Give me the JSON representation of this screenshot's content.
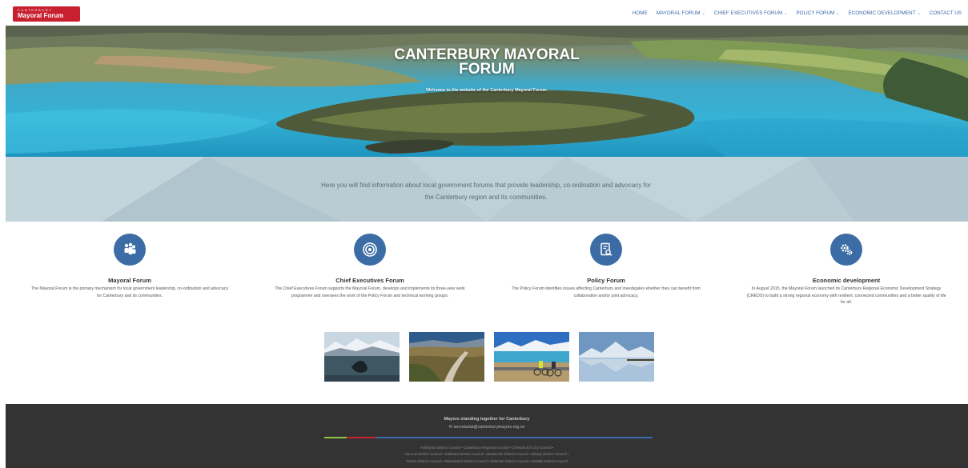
{
  "header": {
    "logo_line1": "CANTERBURY",
    "logo_line2": "Mayoral Forum",
    "nav": [
      {
        "label": "HOME",
        "has_dropdown": false
      },
      {
        "label": "MAYORAL FORUM",
        "has_dropdown": true
      },
      {
        "label": "CHIEF EXECUTIVES FORUM",
        "has_dropdown": true
      },
      {
        "label": "POLICY FORUM",
        "has_dropdown": true
      },
      {
        "label": "ECONOMIC DEVELOPMENT",
        "has_dropdown": true
      },
      {
        "label": "CONTACT US",
        "has_dropdown": false
      }
    ]
  },
  "hero": {
    "title_line1": "CANTERBURY MAYORAL",
    "title_line2": "FORUM",
    "subtitle": "Welcome to the website of the Canterbury Mayoral Forum."
  },
  "intro": {
    "text": "Here you will find information about local government forums that provide leadership, co-ordination and advocacy for the Canterbury region and its communities."
  },
  "features": [
    {
      "icon": "group-icon",
      "title": "Mayoral Forum",
      "description": "The Mayoral Forum is the primary mechanism for local government leadership, co-ordination and advocacy for Canterbury and its communities."
    },
    {
      "icon": "target-icon",
      "title": "Chief Executives Forum",
      "description": "The Chief Executives Forum supports the Mayoral Forum, develops and implements its three-year work programme and oversees the work of the Policy Forum and technical working groups."
    },
    {
      "icon": "document-search-icon",
      "title": "Policy Forum",
      "description": "The Policy Forum identifies issues affecting Canterbury and investigates whether they can benefit from collaboration and/or joint advocacy."
    },
    {
      "icon": "gears-icon",
      "title": "Economic development",
      "description": "In August 2015, the Mayoral Forum launched its Canterbury Regional Economic Development Strategy (CREDS) to build a strong regional economy with resilient, connected communities and a better quality of life for all."
    }
  ],
  "gallery": [
    {
      "icon": "whale-photo"
    },
    {
      "icon": "valley-road-photo"
    },
    {
      "icon": "cyclists-lake-photo"
    },
    {
      "icon": "mountain-lake-photo"
    }
  ],
  "footer": {
    "tagline": "Mayors standing together for Canterbury",
    "email": "secretariat@canterburymayors.org.nz",
    "links_line1": "Ashburton District Council • Canterbury Regional Council • Christchurch City Council •",
    "links_line2": "Hurunui District Council • Kaikōura District Council • Mackenzie District Council • Selwyn District Council •",
    "links_line3": "Timaru District Council • Waimakariri District Council • Waimate District Council • Waitaki District Council"
  },
  "colors": {
    "brand_red": "#c8202f",
    "nav_blue": "#3b6aa8",
    "icon_blue": "#3c6ca6",
    "intro_band": "#b9ccd4",
    "footer_bg": "#333333",
    "footer_bar_green": "#8dc63f",
    "footer_bar_red": "#c8202f",
    "footer_bar_blue": "#3b6aa8"
  }
}
